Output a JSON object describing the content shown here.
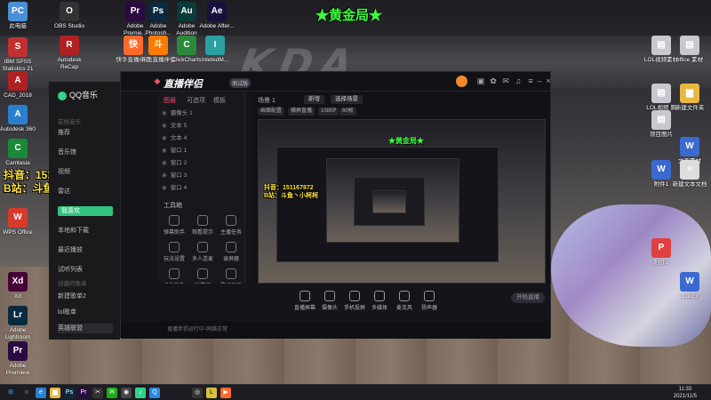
{
  "overlay_title": "★黄金局★",
  "promo_lines": [
    "抖音：151167872",
    "B站：斗鱼丶小柯柯"
  ],
  "desktop_watermark": "KDA",
  "desktop_icons_left": [
    {
      "label": "此电脑",
      "color": "#4a90d9",
      "glyph": "PC"
    },
    {
      "label": "IBM SPSS Statistics 21",
      "color": "#c03030",
      "glyph": "S"
    },
    {
      "label": "CAD_2018",
      "color": "#b02020",
      "glyph": "A"
    },
    {
      "label": "Autodesk 360",
      "color": "#2a7fd0",
      "glyph": "A"
    },
    {
      "label": "Camtasia",
      "color": "#1a8a3a",
      "glyph": "C"
    },
    {
      "label": "WPS Office",
      "color": "#d83a2a",
      "glyph": "W"
    },
    {
      "label": "Xd",
      "color": "#470137",
      "glyph": "Xd"
    },
    {
      "label": "Adobe Lightroom",
      "color": "#0a2a40",
      "glyph": "Lr"
    },
    {
      "label": "Adobe Premiere",
      "color": "#2a0a40",
      "glyph": "Pr"
    }
  ],
  "desktop_icons_top": [
    {
      "label": "OBS Studio",
      "color": "#333",
      "glyph": "O"
    },
    {
      "label": "Adobe Premie...",
      "color": "#2a0a40",
      "glyph": "Pr"
    },
    {
      "label": "Adobe Photosh...",
      "color": "#0a2a40",
      "glyph": "Ps"
    },
    {
      "label": "Adobe Audition",
      "color": "#0a3a3a",
      "glyph": "Au"
    },
    {
      "label": "Adobe After...",
      "color": "#1a1040",
      "glyph": "Ae"
    },
    {
      "label": "Autodesk ReCap",
      "color": "#b02020",
      "glyph": "R"
    },
    {
      "label": "快手直播伴侣",
      "color": "#ff6a2a",
      "glyph": "快"
    },
    {
      "label": "斗鱼直播伴侣",
      "color": "#ff7a00",
      "glyph": "斗"
    },
    {
      "label": "ClickCharts",
      "color": "#2a8a3a",
      "glyph": "C"
    },
    {
      "label": "InletedM...",
      "color": "#2aa0a0",
      "glyph": "I"
    }
  ],
  "desktop_icons_right": [
    {
      "label": "LOL视频素材",
      "color": "#c8c8d0",
      "glyph": "▤"
    },
    {
      "label": "office 素材",
      "color": "#c8c8d0",
      "glyph": "▤"
    },
    {
      "label": "LOL视频 原稿",
      "color": "#c8c8d0",
      "glyph": "▤"
    },
    {
      "label": "新建文件夹",
      "color": "#e8b840",
      "glyph": "▆"
    },
    {
      "label": "项目图片",
      "color": "#c8c8d0",
      "glyph": "▤"
    },
    {
      "label": "文字素材",
      "color": "#3a6ad0",
      "glyph": "W"
    },
    {
      "label": "附件1",
      "color": "#3a6ad0",
      "glyph": "W"
    },
    {
      "label": "新建文本文档",
      "color": "#ddd",
      "glyph": "≡"
    },
    {
      "label": "附件2",
      "color": "#e04040",
      "glyph": "P"
    },
    {
      "label": "1.docx",
      "color": "#3a6ad0",
      "glyph": "W"
    }
  ],
  "qqmusic": {
    "app_name": "QQ音乐",
    "section_online": "在线音乐",
    "items": [
      "推荐",
      "音乐馆",
      "视频",
      "雷达",
      "我喜欢",
      "本地和下载",
      "最近播放",
      "试听列表"
    ],
    "active_index": 4,
    "section_playlist": "创建的歌单",
    "playlists": [
      "新建歌单2",
      "lol歌单",
      "英雄联盟"
    ]
  },
  "stream": {
    "app_name": "直播伴侣",
    "version_badge": "测试版",
    "tabs": [
      "图层",
      "可选项",
      "模板"
    ],
    "layers": [
      "摄像头 1",
      "文本 5",
      "文本 4",
      "窗口 1",
      "窗口 2",
      "窗口 3",
      "窗口 4"
    ],
    "tools_title": "工具箱",
    "tools": [
      "弹幕助手",
      "观看提示",
      "主播任务",
      "玩法设置",
      "多人连麦",
      "录屏器",
      "虚拟形象",
      "弹幕姬",
      "歌词显示",
      "更多"
    ],
    "scene_label": "场景 1",
    "scene_add": "新增",
    "scene_select": "选择场景",
    "mode_chips": [
      "画面配置",
      "横屏直播",
      "1080P",
      "60帧"
    ],
    "controls": [
      {
        "label": "直播屏幕",
        "icon": "monitor-icon"
      },
      {
        "label": "摄像头",
        "icon": "camera-icon"
      },
      {
        "label": "手机投屏",
        "icon": "phone-icon"
      },
      {
        "label": "多媒体",
        "icon": "media-icon"
      },
      {
        "label": "麦克风",
        "icon": "mic-icon"
      },
      {
        "label": "扬声器",
        "icon": "speaker-icon"
      }
    ],
    "start_label": "开始直播",
    "status_text": "直播伴侣运行中·网络正常"
  },
  "clock": {
    "time": "11:33",
    "date": "2021/11/5"
  }
}
